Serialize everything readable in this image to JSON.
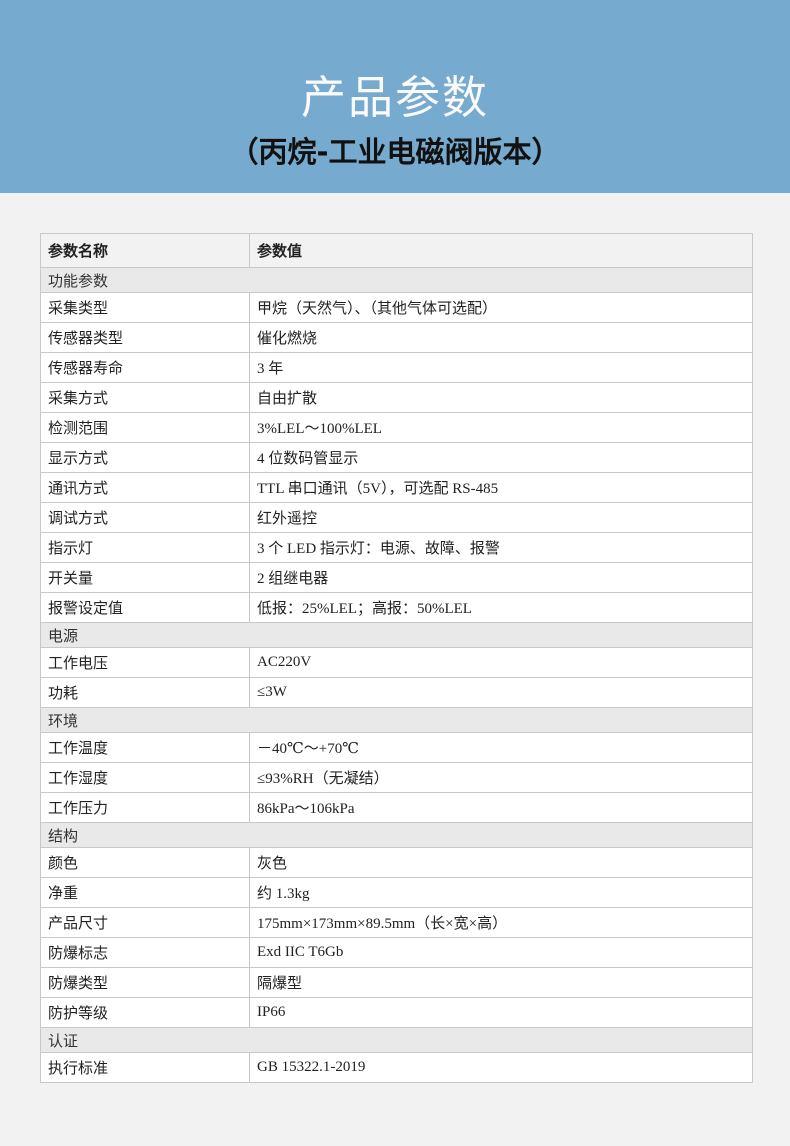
{
  "header": {
    "title": "产品参数",
    "subtitle": "（丙烷-工业电磁阀版本）"
  },
  "table": {
    "columns": [
      "参数名称",
      "参数值"
    ],
    "sections": [
      {
        "title": "功能参数",
        "rows": [
          [
            "采集类型",
            "甲烷（天然气）、（其他气体可选配）"
          ],
          [
            "传感器类型",
            "催化燃烧"
          ],
          [
            "传感器寿命",
            "3 年"
          ],
          [
            "采集方式",
            "自由扩散"
          ],
          [
            "检测范围",
            "3%LEL～100%LEL"
          ],
          [
            "显示方式",
            "4 位数码管显示"
          ],
          [
            "通讯方式",
            "TTL 串口通讯（5V），可选配 RS-485"
          ],
          [
            "调试方式",
            "红外遥控"
          ],
          [
            "指示灯",
            "3 个 LED 指示灯：电源、故障、报警"
          ],
          [
            "开关量",
            "2 组继电器"
          ],
          [
            "报警设定值",
            "低报：25%LEL；高报：50%LEL"
          ]
        ]
      },
      {
        "title": "电源",
        "rows": [
          [
            "工作电压",
            "AC220V"
          ],
          [
            "功耗",
            "≤3W"
          ]
        ]
      },
      {
        "title": "环境",
        "rows": [
          [
            "工作温度",
            "－40℃～+70℃"
          ],
          [
            "工作湿度",
            "≤93%RH（无凝结）"
          ],
          [
            "工作压力",
            "86kPa～106kPa"
          ]
        ]
      },
      {
        "title": "结构",
        "rows": [
          [
            "颜色",
            "灰色"
          ],
          [
            "净重",
            "约 1.3kg"
          ],
          [
            "产品尺寸",
            "175mm×173mm×89.5mm（长×宽×高）"
          ],
          [
            "防爆标志",
            "Exd IIC T6Gb"
          ],
          [
            "防爆类型",
            "隔爆型"
          ],
          [
            "防护等级",
            "IP66"
          ]
        ]
      },
      {
        "title": "认证",
        "rows": [
          [
            "执行标准",
            "GB 15322.1-2019"
          ]
        ]
      }
    ]
  }
}
